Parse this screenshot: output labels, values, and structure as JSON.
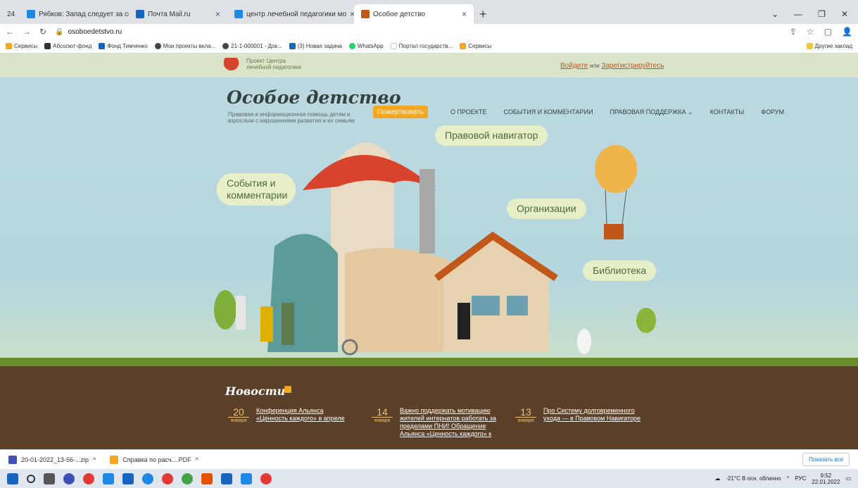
{
  "tabs": [
    {
      "label": "24",
      "color": "#1565c0"
    },
    {
      "label": "Рябков: Запад следует за сфор",
      "color": "#1e88e5"
    },
    {
      "label": "Почта Mail.ru",
      "color": "#1565c0"
    },
    {
      "label": "центр лечебной педагогики мо",
      "color": "#1e88e5"
    },
    {
      "label": "Особое детство",
      "color": "#c2571a"
    }
  ],
  "address": {
    "url": "osoboedetstvo.ru"
  },
  "bookmarks": [
    {
      "label": "Сервисы",
      "color": "#f5a623"
    },
    {
      "label": "Абсолют-фонд",
      "color": "#333333"
    },
    {
      "label": "Фонд Тимченко",
      "color": "#1565c0"
    },
    {
      "label": "Мои проекты вкла...",
      "color": "#444444"
    },
    {
      "label": "21-1-000001 - Док...",
      "color": "#444444"
    },
    {
      "label": "(3) Новая задача",
      "color": "#1565c0"
    },
    {
      "label": "WhatsApp",
      "color": "#25d366"
    },
    {
      "label": "Портал государств...",
      "color": "#ffffff"
    },
    {
      "label": "Сервисы",
      "color": "#f5a623"
    },
    {
      "label": "Другие заклад",
      "color": "#f5c542"
    }
  ],
  "site": {
    "brand_line1": "Проект Центра",
    "brand_line2": "лечебной педагогики",
    "auth_login": "Войдите",
    "auth_or": "или",
    "auth_register": "Зарегистрируйтесь",
    "name": "Особое детство",
    "tagline": "Правовая и информационная помощь детям и взрослым с нарушениями развития и их семьям",
    "donate": "Пожертвовать",
    "nav": [
      "О ПРОЕКТЕ",
      "СОБЫТИЯ И КОММЕНТАРИИ",
      "ПРАВОВАЯ ПОДДЕРЖКА ⌄",
      "КОНТАКТЫ",
      "ФОРУМ"
    ],
    "bubbles": {
      "navigator": "Правовой навигатор",
      "events": "События и комментарии",
      "orgs": "Организации",
      "library": "Библиотека"
    }
  },
  "news": {
    "title": "Новости",
    "items": [
      {
        "day": "20",
        "month": "января",
        "text": "Конференция Альянса «Ценность каждого» в апреле"
      },
      {
        "day": "14",
        "month": "января",
        "text": "Важно поддержать мотивацию жителей интернатов работать за пределами ПНИ! Обращение Альянса «Ценность каждого» к"
      },
      {
        "day": "13",
        "month": "января",
        "text": "Про Систему долговременного ухода — в Правовом Навигаторе"
      }
    ]
  },
  "downloads": [
    {
      "label": "20-01-2022_13-56-...zip",
      "color": "#3f51b5"
    },
    {
      "label": "Справка по расч....PDF",
      "color": "#f5a623"
    }
  ],
  "downloads_showall": "Показать все",
  "taskbar": {
    "weather": "-21°C В осн. облачно",
    "lang": "РУС",
    "time": "9:52",
    "date": "22.01.2022"
  }
}
